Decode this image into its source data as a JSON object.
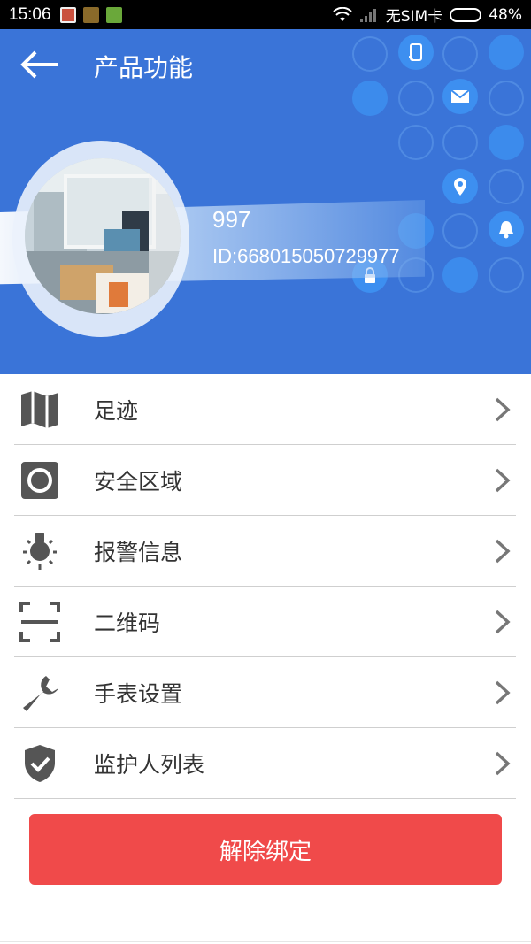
{
  "status_bar": {
    "time": "15:06",
    "carrier": "无SIM卡",
    "battery": "48%",
    "battery_level": 0.48
  },
  "header": {
    "title": "产品功能",
    "device_name": "997",
    "device_id": "ID:668015050729977"
  },
  "menu": [
    {
      "label": "足迹",
      "icon": "map-icon"
    },
    {
      "label": "安全区域",
      "icon": "safe-zone-icon"
    },
    {
      "label": "报警信息",
      "icon": "alarm-bulb-icon"
    },
    {
      "label": "二维码",
      "icon": "qr-scan-icon"
    },
    {
      "label": "手表设置",
      "icon": "wrench-icon"
    },
    {
      "label": "监护人列表",
      "icon": "shield-check-icon"
    }
  ],
  "unbind_label": "解除绑定",
  "colors": {
    "header_bg": "#3a74d8",
    "unbind_bg": "#f04a4a",
    "icon_gray": "#555555"
  }
}
